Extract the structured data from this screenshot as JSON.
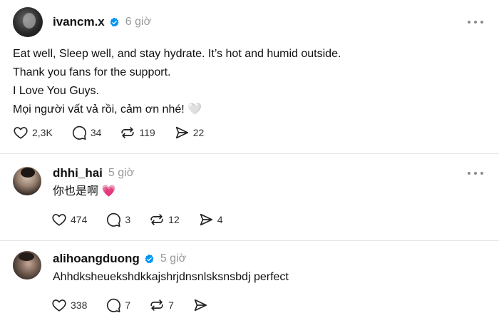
{
  "posts": [
    {
      "username": "ivancm.x",
      "verified": true,
      "time": "6 giờ",
      "lines": [
        "Eat well, Sleep well, and stay hydrate. It’s hot and humid outside.",
        "Thank you fans for the support.",
        "I Love You Guys.",
        "Mọi người vất vả rồi, cảm ơn nhé! 🤍"
      ],
      "likes": "2,3K",
      "replies": "34",
      "reposts": "119",
      "shares": "22"
    },
    {
      "username": "dhhi_hai",
      "verified": false,
      "time": "5 giờ",
      "lines": [
        "你也是啊 💗"
      ],
      "likes": "474",
      "replies": "3",
      "reposts": "12",
      "shares": "4"
    },
    {
      "username": "alihoangduong",
      "verified": true,
      "time": "5 giờ",
      "lines": [
        "Ahhdksheuekshdkkajshrjdnsnlsksnsbdj perfect"
      ],
      "likes": "338",
      "replies": "7",
      "reposts": "7",
      "shares": ""
    }
  ],
  "icons": {
    "like": "heart-icon",
    "reply": "comment-icon",
    "repost": "repost-icon",
    "share": "send-icon",
    "more": "more-options-icon",
    "verified": "verified-badge-icon"
  },
  "colors": {
    "verified": "#0095f6",
    "muted": "#999999",
    "divider": "#e6e6e6"
  }
}
